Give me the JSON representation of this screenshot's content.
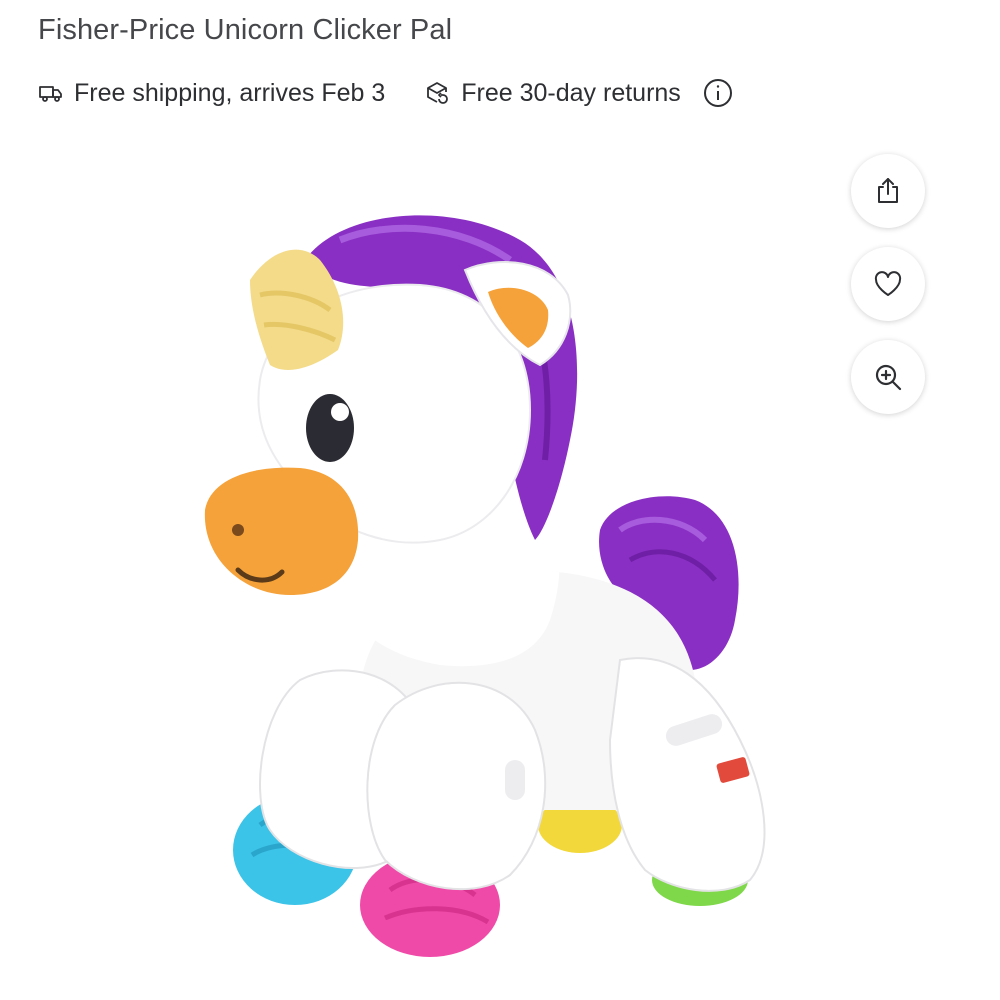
{
  "product": {
    "title": "Fisher-Price Unicorn Clicker Pal"
  },
  "fulfillment": {
    "shipping_text": "Free shipping, arrives Feb 3",
    "shipping_icon": "truck-icon",
    "returns_text": "Free 30-day returns",
    "returns_icon": "returns-box-icon",
    "info_icon": "info-icon"
  },
  "actions": {
    "share_icon": "share-icon",
    "favorite_icon": "heart-icon",
    "zoom_icon": "zoom-in-icon"
  },
  "colors": {
    "text": "#2e2f32",
    "mane_purple": "#8a2fc4",
    "muzzle_orange": "#f5a23a",
    "horn_yellow": "#f3db8a",
    "wheel_blue": "#3cc3e8",
    "wheel_pink": "#f04aa8",
    "wheel_green": "#7fd84a",
    "wheel_yellow": "#f2d83a"
  }
}
